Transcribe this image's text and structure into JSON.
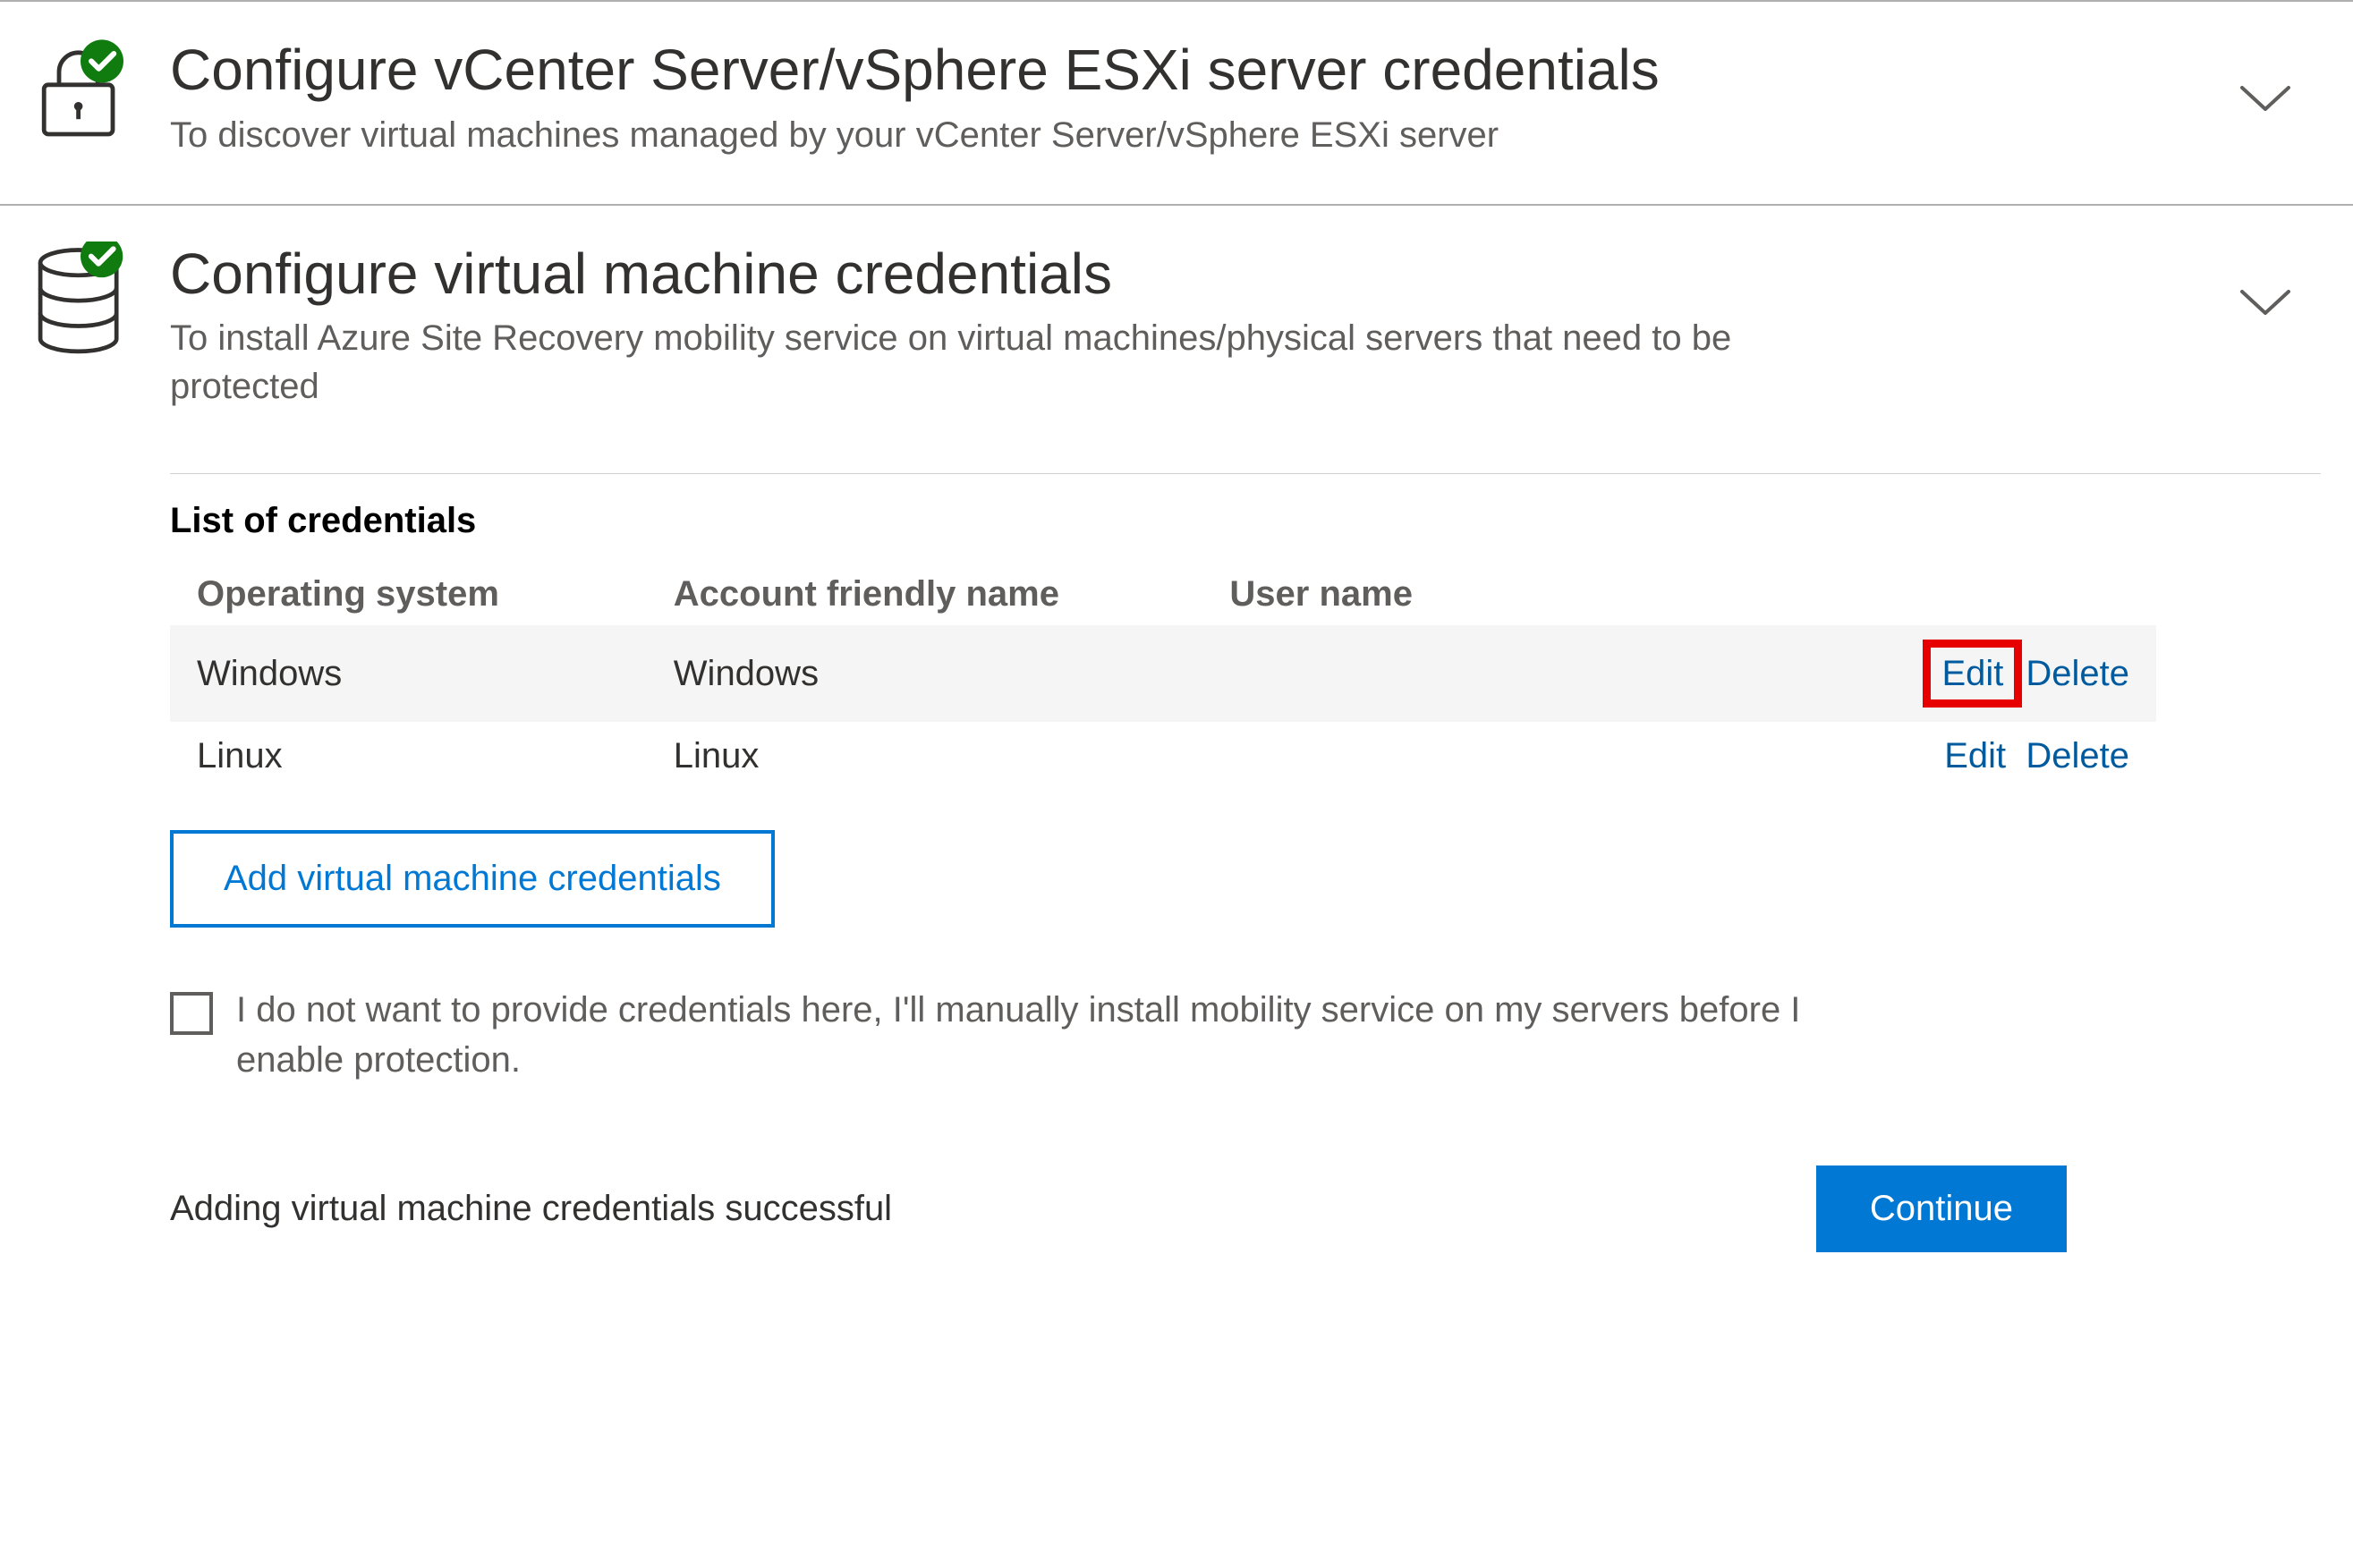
{
  "colors": {
    "accent": "#0078d4",
    "success": "#107c10",
    "highlight_border": "#e60000",
    "text_secondary": "#605e5c"
  },
  "section1": {
    "title": "Configure vCenter Server/vSphere ESXi server credentials",
    "subtitle": "To discover virtual machines managed by your vCenter Server/vSphere ESXi server",
    "status": "complete",
    "icon": "lock-icon"
  },
  "section2": {
    "title": "Configure virtual machine credentials",
    "subtitle": "To install Azure Site Recovery mobility service on virtual machines/physical servers that need to be protected",
    "status": "complete",
    "icon": "database-icon"
  },
  "credentials": {
    "list_title": "List of credentials",
    "columns": {
      "os": "Operating system",
      "friendly": "Account friendly name",
      "user": "User name"
    },
    "rows": [
      {
        "os": "Windows",
        "friendly": "Windows",
        "user": "",
        "highlighted": true
      },
      {
        "os": "Linux",
        "friendly": "Linux",
        "user": "",
        "highlighted": false
      }
    ],
    "actions": {
      "edit": "Edit",
      "delete": "Delete"
    },
    "add_button": "Add virtual machine credentials"
  },
  "checkbox": {
    "checked": false,
    "label": "I do not want to provide credentials here, I'll manually install mobility service on my servers before I enable protection."
  },
  "footer": {
    "status": "Adding virtual machine credentials successful",
    "continue": "Continue"
  }
}
